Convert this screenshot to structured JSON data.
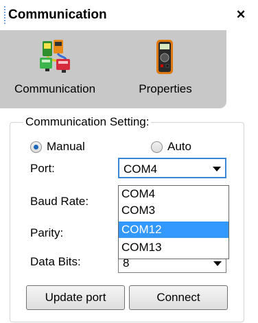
{
  "panel": {
    "title": "Communication",
    "close_symbol": "×"
  },
  "tabs": [
    {
      "label": "Communication",
      "icon": "communication-icon"
    },
    {
      "label": "Properties",
      "icon": "multimeter-icon"
    }
  ],
  "settings": {
    "group_title": "Communication Setting:",
    "mode_options": [
      {
        "label": "Manual",
        "checked": true
      },
      {
        "label": "Auto",
        "checked": false
      }
    ],
    "port": {
      "label": "Port:",
      "value": "COM4"
    },
    "baud_rate": {
      "label": "Baud Rate:"
    },
    "parity": {
      "label": "Parity:"
    },
    "data_bits": {
      "label": "Data Bits:",
      "value": "8"
    },
    "port_dropdown": {
      "options": [
        "COM4",
        "COM3",
        "COM12",
        "COM13"
      ],
      "highlighted": "COM12"
    }
  },
  "buttons": {
    "update_port": "Update port",
    "connect": "Connect"
  },
  "colors": {
    "selection": "#3399ff",
    "focus_border": "#3a86d6",
    "tab_background": "#c8c8c8"
  }
}
